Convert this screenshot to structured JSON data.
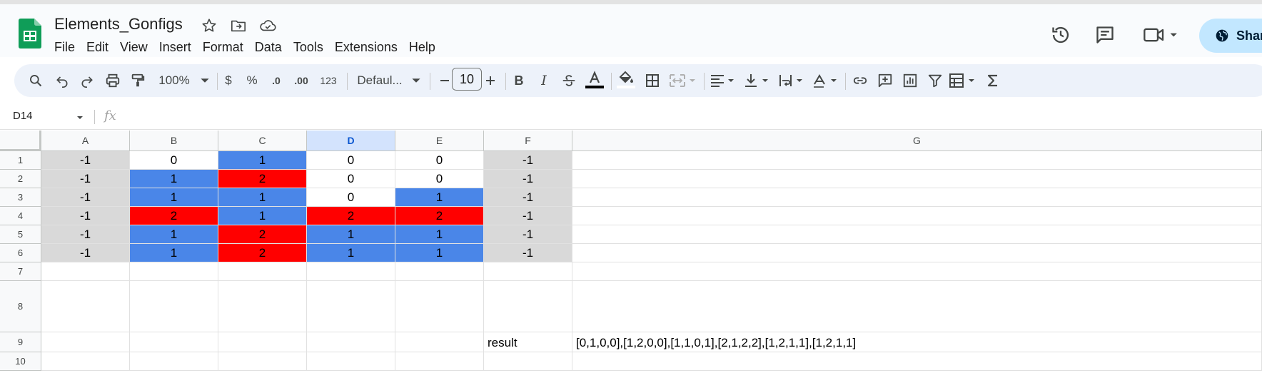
{
  "document": {
    "title": "Elements_Gonfigs"
  },
  "menu": [
    "File",
    "Edit",
    "View",
    "Insert",
    "Format",
    "Data",
    "Tools",
    "Extensions",
    "Help"
  ],
  "header": {
    "share_label": "Shar"
  },
  "toolbar": {
    "zoom": "100%",
    "currency": "$",
    "percent": "%",
    "decrease_decimal": ".0",
    "increase_decimal": ".00",
    "number_format": "123",
    "font": "Defaul...",
    "font_size": "10",
    "bold": "B",
    "italic": "I"
  },
  "formula_bar": {
    "cell_ref": "D14",
    "fx": "fx",
    "content": ""
  },
  "sheet": {
    "columns": [
      "A",
      "B",
      "C",
      "D",
      "E",
      "F",
      "G"
    ],
    "selected_column": "D",
    "rows": [
      "1",
      "2",
      "3",
      "4",
      "5",
      "6",
      "7",
      "8",
      "9",
      "10"
    ],
    "cells": [
      [
        {
          "v": "-1",
          "bg": "gray"
        },
        {
          "v": "0",
          "bg": "white"
        },
        {
          "v": "1",
          "bg": "blue"
        },
        {
          "v": "0",
          "bg": "white"
        },
        {
          "v": "0",
          "bg": "white"
        },
        {
          "v": "-1",
          "bg": "gray"
        },
        {
          "v": "",
          "bg": "white"
        }
      ],
      [
        {
          "v": "-1",
          "bg": "gray"
        },
        {
          "v": "1",
          "bg": "blue"
        },
        {
          "v": "2",
          "bg": "red"
        },
        {
          "v": "0",
          "bg": "white"
        },
        {
          "v": "0",
          "bg": "white"
        },
        {
          "v": "-1",
          "bg": "gray"
        },
        {
          "v": "",
          "bg": "white"
        }
      ],
      [
        {
          "v": "-1",
          "bg": "gray"
        },
        {
          "v": "1",
          "bg": "blue"
        },
        {
          "v": "1",
          "bg": "blue"
        },
        {
          "v": "0",
          "bg": "white"
        },
        {
          "v": "1",
          "bg": "blue"
        },
        {
          "v": "-1",
          "bg": "gray"
        },
        {
          "v": "",
          "bg": "white"
        }
      ],
      [
        {
          "v": "-1",
          "bg": "gray"
        },
        {
          "v": "2",
          "bg": "red"
        },
        {
          "v": "1",
          "bg": "blue"
        },
        {
          "v": "2",
          "bg": "red"
        },
        {
          "v": "2",
          "bg": "red"
        },
        {
          "v": "-1",
          "bg": "gray"
        },
        {
          "v": "",
          "bg": "white"
        }
      ],
      [
        {
          "v": "-1",
          "bg": "gray"
        },
        {
          "v": "1",
          "bg": "blue"
        },
        {
          "v": "2",
          "bg": "red"
        },
        {
          "v": "1",
          "bg": "blue"
        },
        {
          "v": "1",
          "bg": "blue"
        },
        {
          "v": "-1",
          "bg": "gray"
        },
        {
          "v": "",
          "bg": "white"
        }
      ],
      [
        {
          "v": "-1",
          "bg": "gray"
        },
        {
          "v": "1",
          "bg": "blue"
        },
        {
          "v": "2",
          "bg": "red"
        },
        {
          "v": "1",
          "bg": "blue"
        },
        {
          "v": "1",
          "bg": "blue"
        },
        {
          "v": "-1",
          "bg": "gray"
        },
        {
          "v": "",
          "bg": "white"
        }
      ],
      [
        {
          "v": "",
          "bg": "white"
        },
        {
          "v": "",
          "bg": "white"
        },
        {
          "v": "",
          "bg": "white"
        },
        {
          "v": "",
          "bg": "white"
        },
        {
          "v": "",
          "bg": "white"
        },
        {
          "v": "",
          "bg": "white"
        },
        {
          "v": "",
          "bg": "white"
        }
      ],
      [
        {
          "v": "",
          "bg": "white"
        },
        {
          "v": "",
          "bg": "white"
        },
        {
          "v": "",
          "bg": "white"
        },
        {
          "v": "",
          "bg": "white"
        },
        {
          "v": "",
          "bg": "white"
        },
        {
          "v": "",
          "bg": "white"
        },
        {
          "v": "",
          "bg": "white"
        }
      ],
      [
        {
          "v": "",
          "bg": "white"
        },
        {
          "v": "",
          "bg": "white"
        },
        {
          "v": "",
          "bg": "white"
        },
        {
          "v": "",
          "bg": "white"
        },
        {
          "v": "",
          "bg": "white"
        },
        {
          "v": "result",
          "bg": "white",
          "align": "left"
        },
        {
          "v": "[0,1,0,0],[1,2,0,0],[1,1,0,1],[2,1,2,2],[1,2,1,1],[1,2,1,1]",
          "bg": "white",
          "align": "left"
        }
      ],
      [
        {
          "v": "",
          "bg": "white"
        },
        {
          "v": "",
          "bg": "white"
        },
        {
          "v": "",
          "bg": "white"
        },
        {
          "v": "",
          "bg": "white"
        },
        {
          "v": "",
          "bg": "white"
        },
        {
          "v": "",
          "bg": "white"
        },
        {
          "v": "",
          "bg": "white"
        }
      ]
    ]
  },
  "colors": {
    "gray": "#d9d9d9",
    "blue": "#4a86e8",
    "red": "#ff0000",
    "white": "#ffffff",
    "accent": "#0b57d0"
  }
}
